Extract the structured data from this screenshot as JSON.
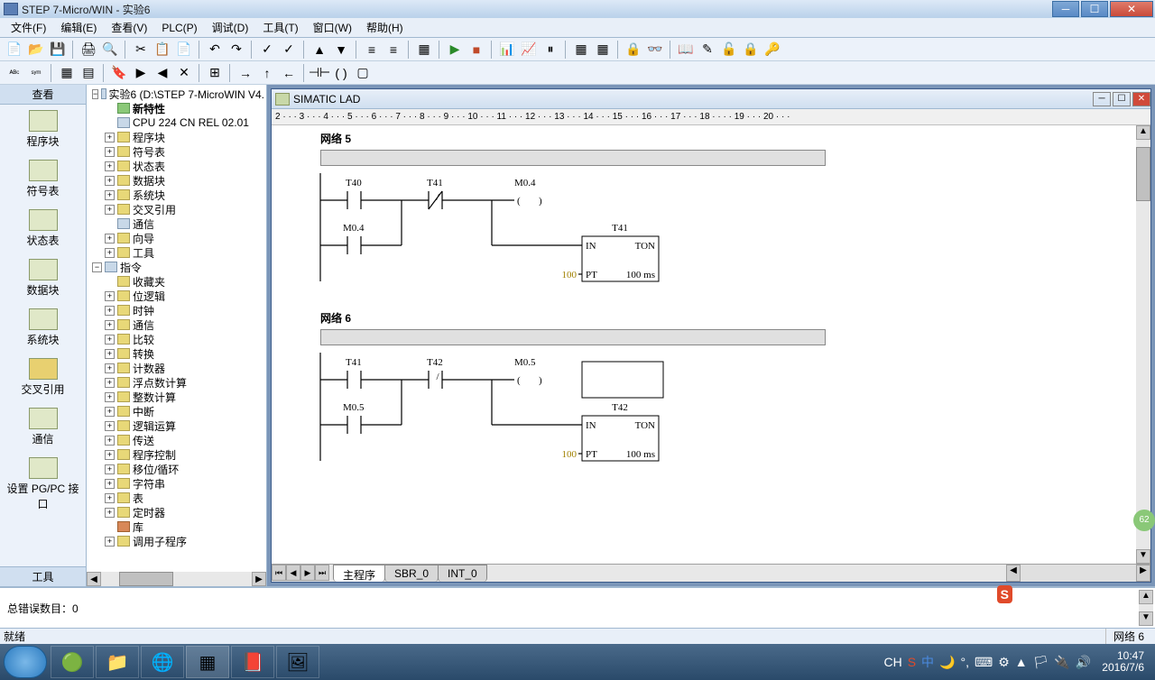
{
  "titlebar": {
    "title": "STEP 7-Micro/WIN - 实验6"
  },
  "menus": [
    "文件(F)",
    "编辑(E)",
    "查看(V)",
    "PLC(P)",
    "调试(D)",
    "工具(T)",
    "窗口(W)",
    "帮助(H)"
  ],
  "nav": {
    "header": "查看",
    "items": [
      "程序块",
      "符号表",
      "状态表",
      "数据块",
      "系统块",
      "交叉引用",
      "通信",
      "设置 PG/PC 接口"
    ],
    "footer": "工具"
  },
  "tree": {
    "root": "实验6 (D:\\STEP 7-MicroWIN V4.",
    "new_feature": "新特性",
    "cpu": "CPU 224 CN REL 02.01",
    "blocks": [
      "程序块",
      "符号表",
      "状态表",
      "数据块",
      "系统块",
      "交叉引用",
      "通信",
      "向导",
      "工具"
    ],
    "inst_header": "指令",
    "inst": [
      "收藏夹",
      "位逻辑",
      "时钟",
      "通信",
      "比较",
      "转换",
      "计数器",
      "浮点数计算",
      "整数计算",
      "中断",
      "逻辑运算",
      "传送",
      "程序控制",
      "移位/循环",
      "字符串",
      "表",
      "定时器",
      "库",
      "调用子程序"
    ]
  },
  "doc": {
    "title": "SIMATIC LAD",
    "ruler": "2 · · · 3 · · · 4 · · · 5 · · · 6 · · · 7 · · · 8 · · · 9 · · · 10 · · · 11 · · · 12 · · · 13 · · · 14 · · · 15 · · · 16 · · · 17 · · · 18 · · ·   · 19 · · · 20 · · ·",
    "net5_title": "网络 5",
    "net6_title": "网络 6",
    "tabs": [
      "主程序",
      "SBR_0",
      "INT_0"
    ]
  },
  "ladder": {
    "net5": {
      "c1": "T40",
      "c2": "T41",
      "coil": "M0.4",
      "branch": "M0.4",
      "timer_name": "T41",
      "timer_in": "IN",
      "timer_type": "TON",
      "pt": "PT",
      "pt_val": "100",
      "pt_unit": "100 ms"
    },
    "net6": {
      "c1": "T41",
      "c2": "T42",
      "coil": "M0.5",
      "branch": "M0.5",
      "timer_name": "T42",
      "timer_in": "IN",
      "timer_type": "TON",
      "pt": "PT",
      "pt_val": "100",
      "pt_unit": "100 ms"
    }
  },
  "output": {
    "msg": "总错误数目：0"
  },
  "status": {
    "ready": "就绪",
    "net": "网络 6"
  },
  "taskbar": {
    "ime_cn": "CH",
    "time": "10:47",
    "date": "2016/7/6"
  },
  "ime_badge": "S",
  "side_badge": "62"
}
